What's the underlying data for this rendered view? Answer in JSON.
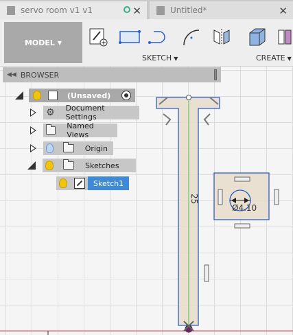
{
  "tabs": [
    {
      "label": "servo room v1 v1",
      "active": true
    },
    {
      "label": "Untitled*",
      "active": false
    }
  ],
  "toolbar": {
    "workspace_label": "MODEL",
    "sketch_group_label": "SKETCH",
    "create_group_label": "CREATE",
    "sketch_tools": [
      "create-sketch-icon",
      "rectangle-icon",
      "line-icon",
      "arc-icon",
      "mirror-icon"
    ],
    "create_tools": [
      "box-icon",
      "pattern-icon"
    ]
  },
  "browser": {
    "title": "BROWSER",
    "root": {
      "label": "(Unsaved)"
    },
    "items": [
      {
        "label": "Document Settings",
        "icon": "gear-icon"
      },
      {
        "label": "Named Views",
        "icon": "folder-icon"
      },
      {
        "label": "Origin",
        "icon": "folder-icon"
      },
      {
        "label": "Sketches",
        "icon": "folder-icon"
      },
      {
        "label": "Sketch1",
        "icon": "sketch-icon"
      }
    ]
  },
  "canvas": {
    "dimension_vertical": "25",
    "dimension_diameter": "Ø4.10"
  },
  "colors": {
    "sketch_line": "#2b5fc7",
    "sketch_fill": "#e8dccb",
    "axis_green": "#59c04c",
    "axis_red": "#e04a4a",
    "selection_blue": "#3f8ad6"
  }
}
